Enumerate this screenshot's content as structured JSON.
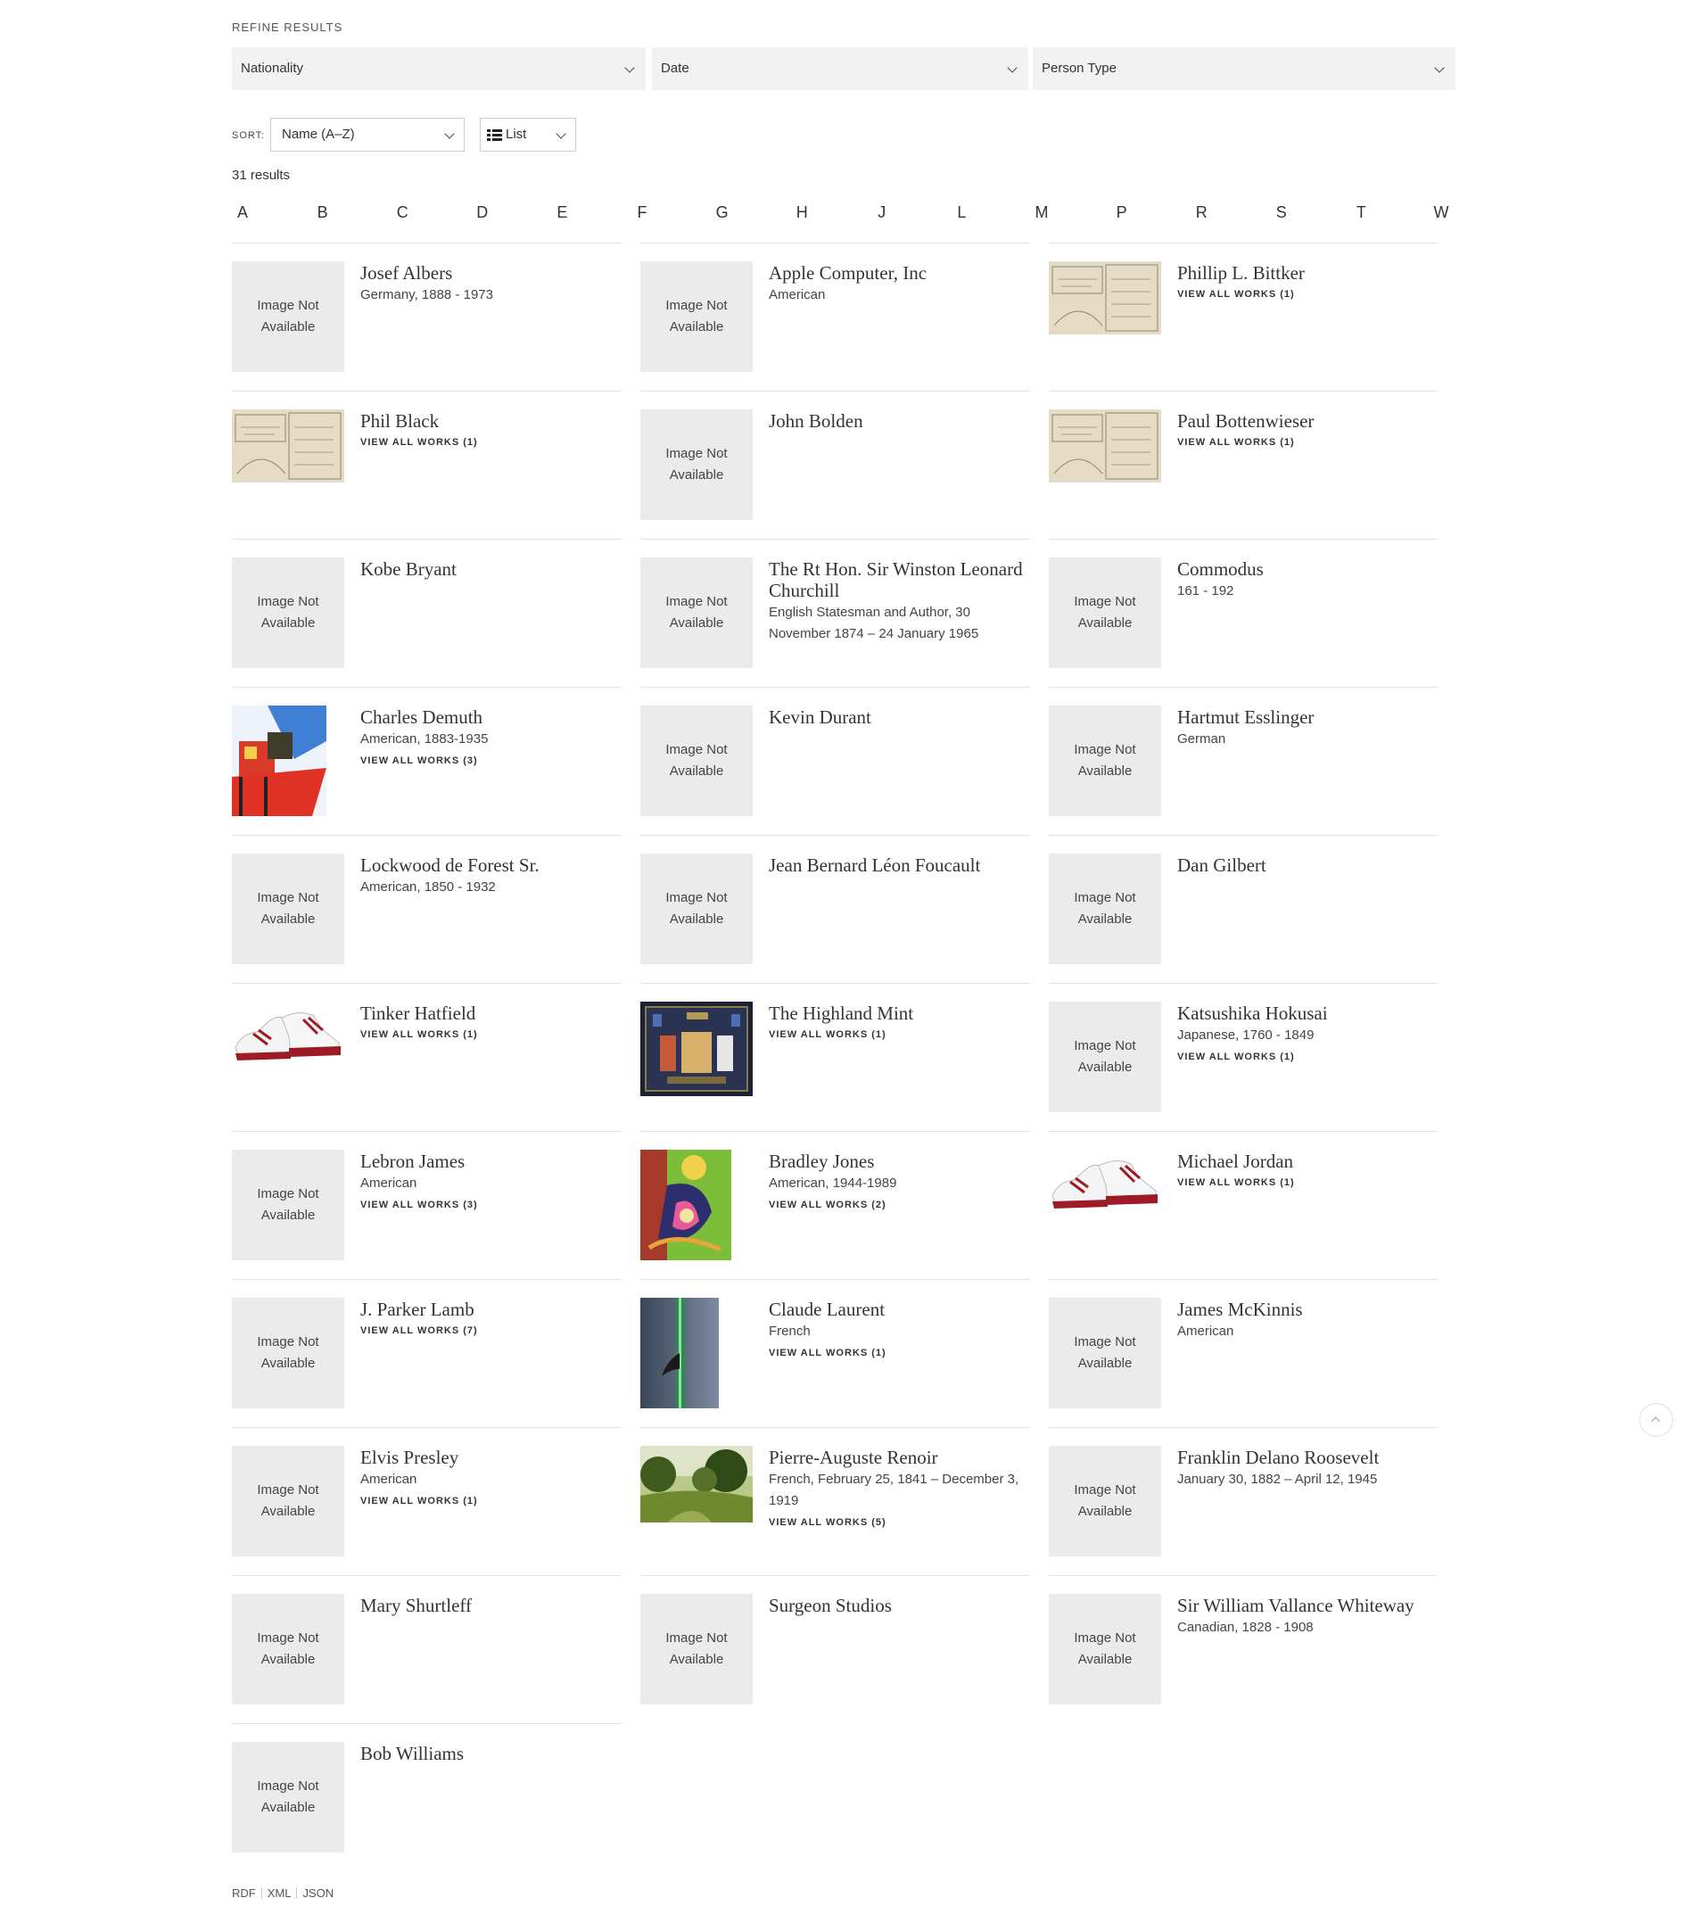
{
  "refine": {
    "label": "REFINE RESULTS"
  },
  "filters": [
    {
      "label": "Nationality"
    },
    {
      "label": "Date"
    },
    {
      "label": "Person Type"
    }
  ],
  "sort": {
    "label": "SORT:",
    "value": "Name (A–Z)",
    "view": "List"
  },
  "results": {
    "count_text": "31 results"
  },
  "alphabet": [
    "A",
    "B",
    "C",
    "D",
    "E",
    "F",
    "G",
    "H",
    "J",
    "L",
    "M",
    "P",
    "R",
    "S",
    "T",
    "W"
  ],
  "image_not_available": "Image Not Available",
  "people": [
    {
      "name": "Josef Albers",
      "lines": [
        "Germany, 1888 - 1973"
      ],
      "works": "",
      "image": "none"
    },
    {
      "name": "Apple Computer, Inc",
      "lines": [
        "American"
      ],
      "works": "",
      "image": "none"
    },
    {
      "name": "Phillip L. Bittker",
      "lines": [],
      "works": "VIEW ALL WORKS (1)",
      "image": "sketch"
    },
    {
      "name": "Phil Black",
      "lines": [],
      "works": "VIEW ALL WORKS (1)",
      "image": "sketch"
    },
    {
      "name": "John Bolden",
      "lines": [],
      "works": "",
      "image": "none"
    },
    {
      "name": "Paul Bottenwieser",
      "lines": [],
      "works": "VIEW ALL WORKS (1)",
      "image": "sketch"
    },
    {
      "name": "Kobe Bryant",
      "lines": [],
      "works": "",
      "image": "none"
    },
    {
      "name": "The Rt Hon. Sir Winston Leonard Churchill",
      "lines": [
        "English Statesman and Author, 30 November 1874 – 24 January 1965"
      ],
      "works": "",
      "image": "none"
    },
    {
      "name": "Commodus",
      "lines": [
        "161 - 192"
      ],
      "works": "",
      "image": "none"
    },
    {
      "name": "Charles Demuth",
      "lines": [
        "American, 1883-1935"
      ],
      "works": "VIEW ALL WORKS (3)",
      "image": "painting-tower"
    },
    {
      "name": "Kevin Durant",
      "lines": [],
      "works": "",
      "image": "none"
    },
    {
      "name": "Hartmut Esslinger",
      "lines": [
        "German"
      ],
      "works": "",
      "image": "none"
    },
    {
      "name": "Lockwood de Forest Sr.",
      "lines": [
        "American, 1850 - 1932"
      ],
      "works": "",
      "image": "none"
    },
    {
      "name": "Jean Bernard Léon Foucault",
      "lines": [],
      "works": "",
      "image": "none"
    },
    {
      "name": "Dan Gilbert",
      "lines": [],
      "works": "",
      "image": "none"
    },
    {
      "name": "Tinker Hatfield",
      "lines": [],
      "works": "VIEW ALL WORKS (1)",
      "image": "sneaker"
    },
    {
      "name": "The Highland Mint",
      "lines": [],
      "works": "VIEW ALL WORKS (1)",
      "image": "frame"
    },
    {
      "name": "Katsushika Hokusai",
      "lines": [
        "Japanese, 1760 - 1849"
      ],
      "works": "VIEW ALL WORKS (1)",
      "image": "none"
    },
    {
      "name": "Lebron James",
      "lines": [
        "American"
      ],
      "works": "VIEW ALL WORKS (3)",
      "image": "none"
    },
    {
      "name": "Bradley Jones",
      "lines": [
        "American, 1944-1989"
      ],
      "works": "VIEW ALL WORKS (2)",
      "image": "abstract"
    },
    {
      "name": "Michael Jordan",
      "lines": [],
      "works": "VIEW ALL WORKS (1)",
      "image": "sneaker"
    },
    {
      "name": "J. Parker Lamb",
      "lines": [],
      "works": "VIEW ALL WORKS (7)",
      "image": "none"
    },
    {
      "name": "Claude Laurent",
      "lines": [
        "French"
      ],
      "works": "VIEW ALL WORKS (1)",
      "image": "flute"
    },
    {
      "name": "James McKinnis",
      "lines": [
        "American"
      ],
      "works": "",
      "image": "none"
    },
    {
      "name": "Elvis Presley",
      "lines": [
        "American"
      ],
      "works": "VIEW ALL WORKS (1)",
      "image": "none"
    },
    {
      "name": "Pierre-Auguste Renoir",
      "lines": [
        "French, February 25, 1841 – December 3, 1919"
      ],
      "works": "VIEW ALL WORKS (5)",
      "image": "landscape"
    },
    {
      "name": "Franklin Delano Roosevelt",
      "lines": [
        "January 30, 1882 – April 12, 1945"
      ],
      "works": "",
      "image": "none"
    },
    {
      "name": "Mary Shurtleff",
      "lines": [],
      "works": "",
      "image": "none"
    },
    {
      "name": "Surgeon Studios",
      "lines": [],
      "works": "",
      "image": "none"
    },
    {
      "name": "Sir William Vallance Whiteway",
      "lines": [
        "Canadian, 1828 - 1908"
      ],
      "works": "",
      "image": "none"
    },
    {
      "name": "Bob Williams",
      "lines": [],
      "works": "",
      "image": "none"
    }
  ],
  "footer": {
    "links": [
      "RDF",
      "XML",
      "JSON"
    ]
  }
}
